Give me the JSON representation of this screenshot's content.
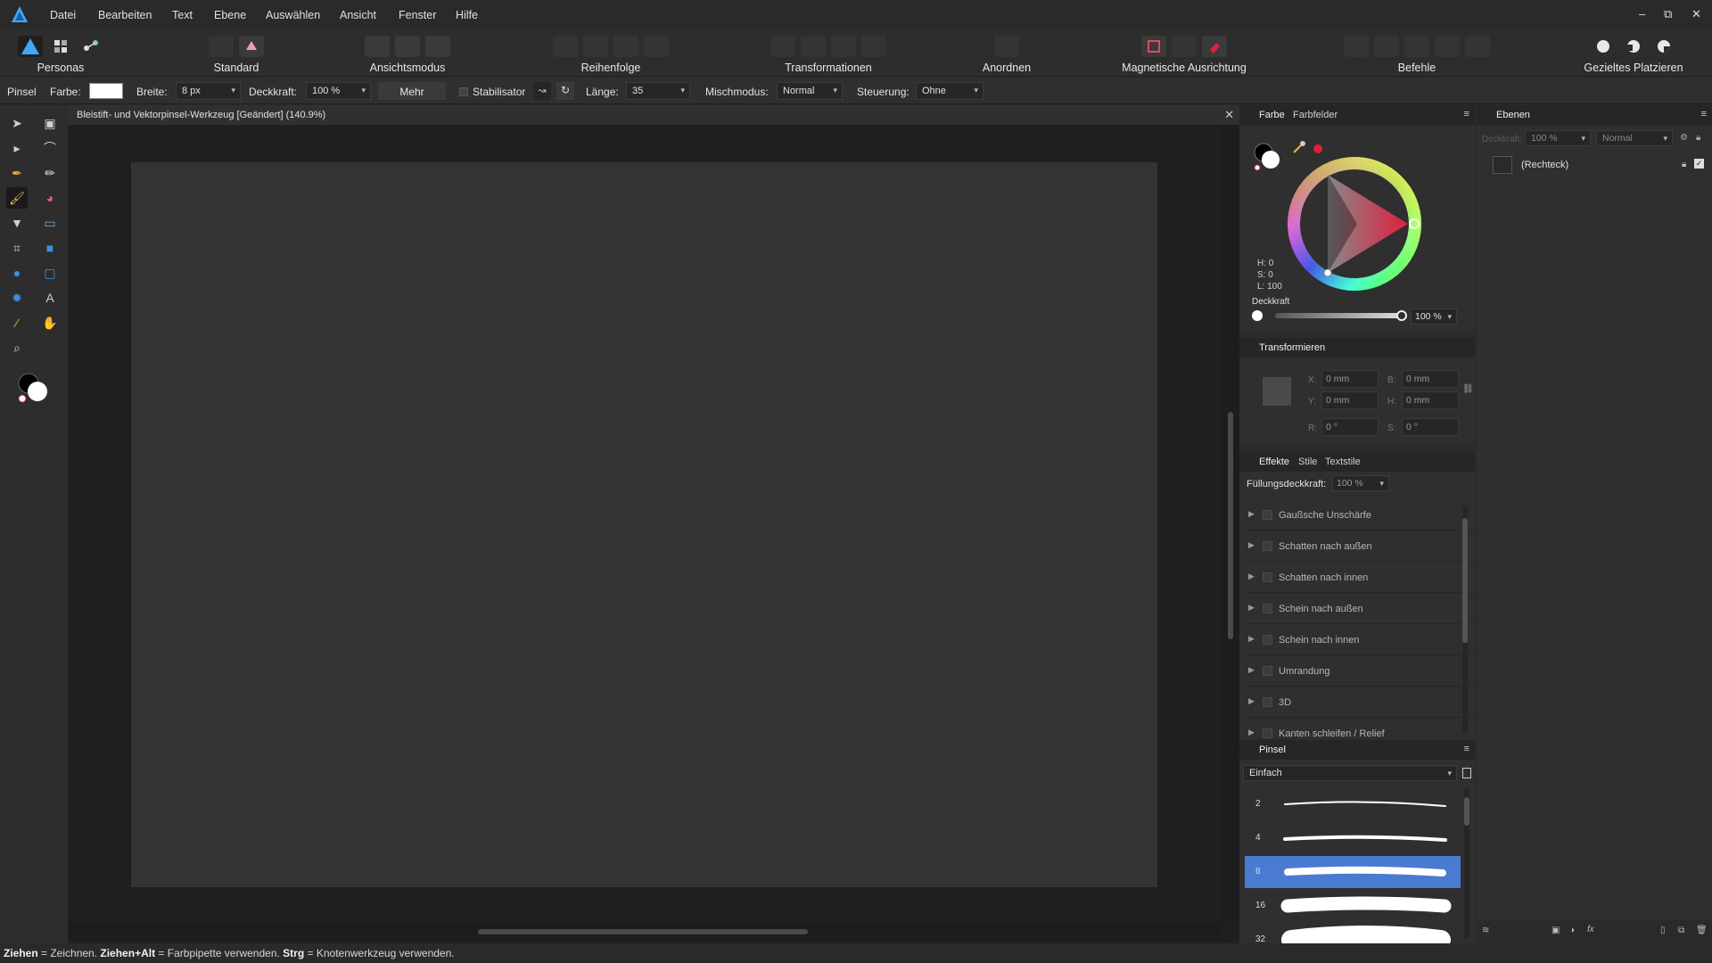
{
  "app": {
    "logo": "affinity-designer-logo"
  },
  "menu": [
    "Datei",
    "Bearbeiten",
    "Text",
    "Ebene",
    "Auswählen",
    "Ansicht",
    "Fenster",
    "Hilfe"
  ],
  "window_controls": {
    "minimize": "–",
    "restore": "⧉",
    "close": "✕"
  },
  "toolbar": {
    "personas": "Personas",
    "standard": "Standard",
    "ansichtsmodus": "Ansichtsmodus",
    "reihenfolge": "Reihenfolge",
    "transformationen": "Transformationen",
    "anordnen": "Anordnen",
    "magnetische": "Magnetische Ausrichtung",
    "befehle": "Befehle",
    "platzieren": "Gezieltes Platzieren"
  },
  "context": {
    "tool": "Pinsel",
    "farbe_label": "Farbe:",
    "breite_label": "Breite:",
    "breite_value": "8 px",
    "deckkraft_label": "Deckkraft:",
    "deckkraft_value": "100 %",
    "mehr": "Mehr",
    "stabilisator": "Stabilisator",
    "laenge_label": "Länge:",
    "laenge_value": "35",
    "mischmodus_label": "Mischmodus:",
    "mischmodus_value": "Normal",
    "steuerung_label": "Steuerung:",
    "steuerung_value": "Ohne"
  },
  "document": {
    "title": "Bleistift- und Vektorpinsel-Werkzeug [Geändert] (140.9%)",
    "close": "✕"
  },
  "color_panel": {
    "tabs": [
      "Farbe",
      "Farbfelder"
    ],
    "h": "H: 0",
    "s": "S: 0",
    "l": "L: 100",
    "deckkraft_label": "Deckkraft",
    "deckkraft_value": "100 %",
    "accent": "#e01f3d"
  },
  "transform_panel": {
    "title": "Transformieren",
    "x_label": "X:",
    "x": "0 mm",
    "y_label": "Y:",
    "y": "0 mm",
    "b_label": "B:",
    "b": "0 mm",
    "h_label": "H:",
    "h": "0 mm",
    "r_label": "R:",
    "r": "0 °",
    "s_label": "S:",
    "s": "0 °"
  },
  "effects_panel": {
    "tabs": [
      "Effekte",
      "Stile",
      "Textstile"
    ],
    "fill_label": "Füllungsdeckkraft:",
    "fill_value": "100 %",
    "items": [
      "Gaußsche Unschärfe",
      "Schatten nach außen",
      "Schatten nach innen",
      "Schein nach außen",
      "Schein nach innen",
      "Umrandung",
      "3D",
      "Kanten schleifen / Relief"
    ]
  },
  "brush_panel": {
    "title": "Pinsel",
    "category": "Einfach",
    "sizes": [
      "2",
      "4",
      "8",
      "16",
      "32"
    ],
    "selected_index": 2,
    "selected_color": "#4a7bd0"
  },
  "layers_panel": {
    "title": "Ebenen",
    "opacity_label": "Deckkraft:",
    "opacity_value": "100 %",
    "blend_value": "Normal",
    "layer_name": "(Rechteck)"
  },
  "status": {
    "k1": "Ziehen",
    "t1": " = Zeichnen. ",
    "k2": "Ziehen+Alt",
    "t2": " = Farbpipette verwenden. ",
    "k3": "Strg",
    "t3": " = Knotenwerkzeug verwenden."
  }
}
